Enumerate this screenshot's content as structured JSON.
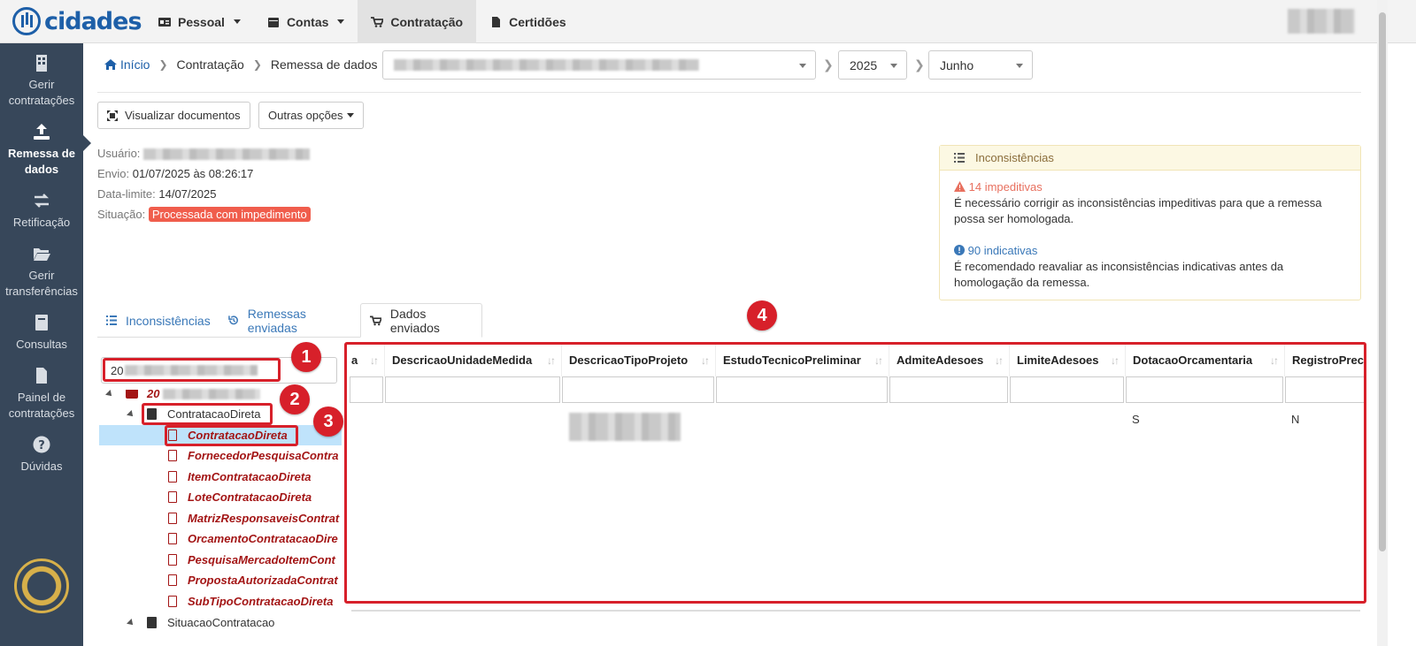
{
  "header": {
    "logo_text": "cidades",
    "nav": [
      {
        "label": "Pessoal",
        "icon": "id-card-icon",
        "dropdown": true
      },
      {
        "label": "Contas",
        "icon": "calendar-icon",
        "dropdown": true
      },
      {
        "label": "Contratação",
        "icon": "cart-icon",
        "dropdown": false,
        "active": true
      },
      {
        "label": "Certidões",
        "icon": "file-icon",
        "dropdown": false
      }
    ]
  },
  "sidebar": {
    "items": [
      {
        "label": "Gerir contratações",
        "icon": "building-icon"
      },
      {
        "label": "Remessa de dados",
        "icon": "upload-icon",
        "active": true
      },
      {
        "label": "Retificação",
        "icon": "exchange-icon"
      },
      {
        "label": "Gerir transferências",
        "icon": "folder-open-icon"
      },
      {
        "label": "Consultas",
        "icon": "book-icon"
      },
      {
        "label": "Painel de contratações",
        "icon": "file-icon"
      },
      {
        "label": "Dúvidas",
        "icon": "question-icon"
      }
    ]
  },
  "breadcrumb": {
    "home": "Início",
    "items": [
      "Contratação",
      "Remessa de dados"
    ],
    "year": "2025",
    "month": "Junho"
  },
  "toolbar": {
    "view_docs": "Visualizar documentos",
    "other_options": "Outras opções"
  },
  "info": {
    "user_label": "Usuário:",
    "send_label": "Envio:",
    "send_value": "01/07/2025 às 08:26:17",
    "deadline_label": "Data-limite:",
    "deadline_value": "14/07/2025",
    "status_label": "Situação:",
    "status_value": "Processada com impedimento"
  },
  "inconsistencies": {
    "title": "Inconsistências",
    "blocking_title": "14 impeditivas",
    "blocking_text": "É necessário corrigir as inconsistências impeditivas para que a remessa possa ser homologada.",
    "indicative_title": "90 indicativas",
    "indicative_text": "É recomendado reavaliar as inconsistências indicativas antes da homologação da remessa."
  },
  "tabs": [
    {
      "label": "Inconsistências",
      "icon": "list-icon"
    },
    {
      "label": "Remessas enviadas",
      "icon": "history-icon"
    },
    {
      "label": "Dados enviados",
      "icon": "cart-icon",
      "active": true
    }
  ],
  "tree": {
    "search_value": "20",
    "root_prefix": "20",
    "nodes": [
      {
        "label": "ContratacaoDireta",
        "type": "folder"
      },
      {
        "label": "ContratacaoDireta",
        "type": "file",
        "selected": true
      },
      {
        "label": "FornecedorPesquisaContra",
        "type": "file"
      },
      {
        "label": "ItemContratacaoDireta",
        "type": "file"
      },
      {
        "label": "LoteContratacaoDireta",
        "type": "file"
      },
      {
        "label": "MatrizResponsaveisContrat",
        "type": "file"
      },
      {
        "label": "OrcamentoContratacaoDire",
        "type": "file"
      },
      {
        "label": "PesquisaMercadoItemCont",
        "type": "file"
      },
      {
        "label": "PropostaAutorizadaContrat",
        "type": "file"
      },
      {
        "label": "SubTipoContratacaoDireta",
        "type": "file"
      },
      {
        "label": "SituacaoContratacao",
        "type": "folder"
      }
    ]
  },
  "table": {
    "columns": [
      "a",
      "DescricaoUnidadeMedida",
      "DescricaoTipoProjeto",
      "EstudoTecnicoPreliminar",
      "AdmiteAdesoes",
      "LimiteAdesoes",
      "DotacaoOrcamentaria",
      "RegistroPrec"
    ],
    "row": {
      "DotacaoOrcamentaria": "S",
      "RegistroPrec": "N"
    }
  },
  "annotations": [
    "1",
    "2",
    "3",
    "4"
  ],
  "colors": {
    "sidebar": "#37475a",
    "accent": "#3a78b8",
    "highlight": "#d7202a",
    "danger_badge": "#f05d4c"
  }
}
